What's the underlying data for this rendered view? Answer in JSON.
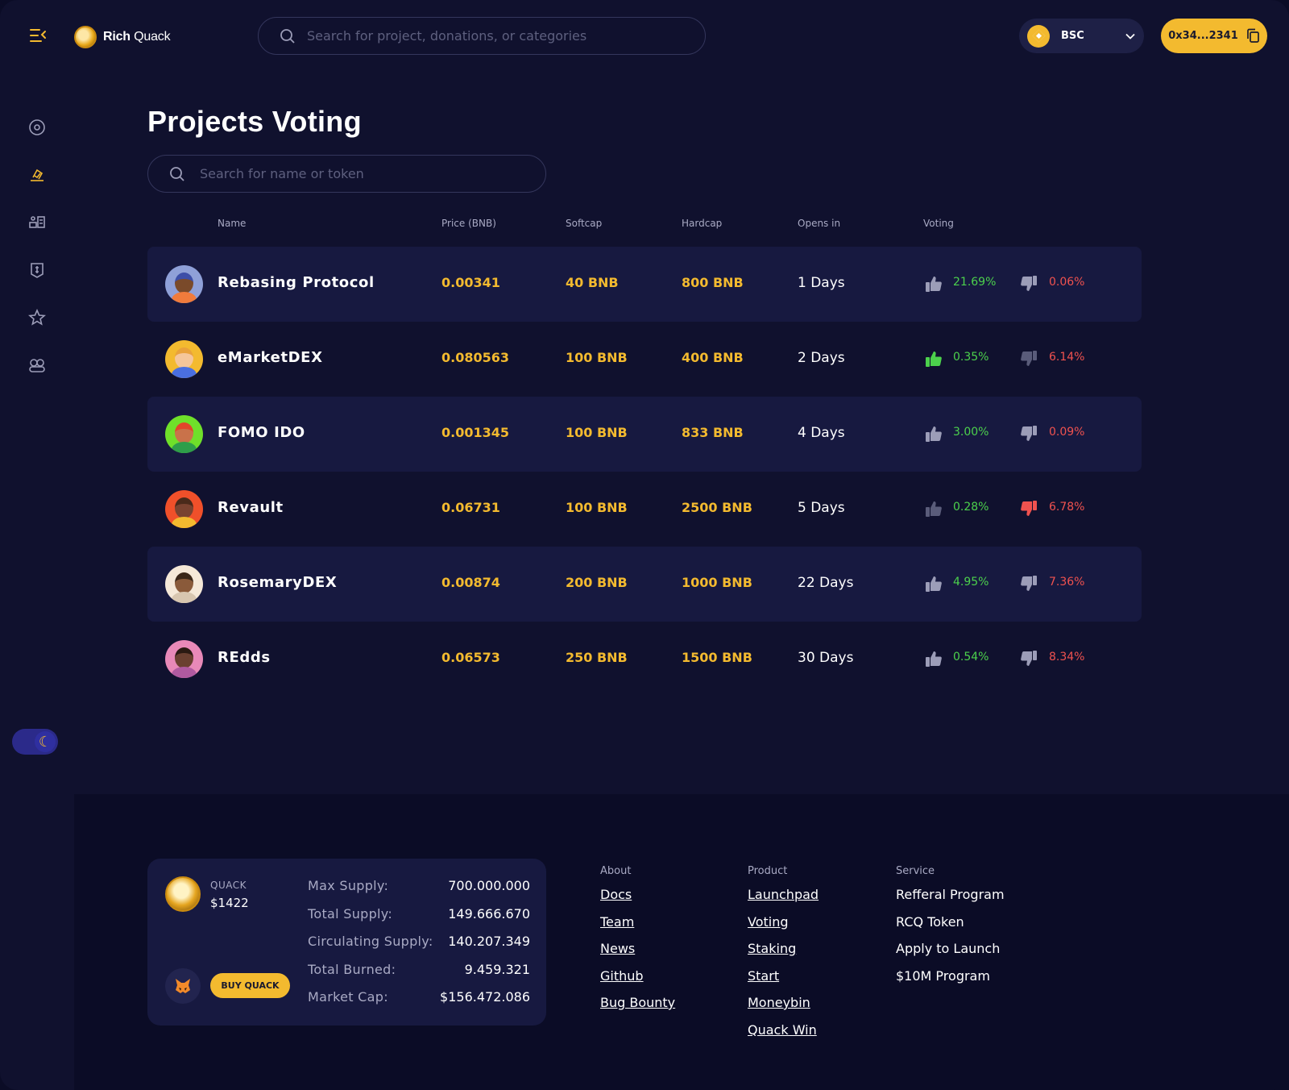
{
  "header": {
    "brand_bold": "Rich",
    "brand_light": " Quack",
    "search_placeholder": "Search for project, donations, or categories",
    "network": "BSC",
    "wallet": "0x34...2341"
  },
  "page": {
    "title": "Projects Voting",
    "search_placeholder": "Search for name or token"
  },
  "table": {
    "columns": [
      "Name",
      "Price (BNB)",
      "Softcap",
      "Hardcap",
      "Opens in",
      "Voting"
    ],
    "rows": [
      {
        "name": "Rebasing Protocol",
        "price": "0.00341",
        "softcap": "40 BNB",
        "hardcap": "800 BNB",
        "opens": "1 Days",
        "up": "21.69%",
        "down": "0.06%",
        "vote": "none"
      },
      {
        "name": "eMarketDEX",
        "price": "0.080563",
        "softcap": "100 BNB",
        "hardcap": "400 BNB",
        "opens": "2 Days",
        "up": "0.35%",
        "down": "6.14%",
        "vote": "up"
      },
      {
        "name": "FOMO IDO",
        "price": "0.001345",
        "softcap": "100 BNB",
        "hardcap": "833 BNB",
        "opens": "4 Days",
        "up": "3.00%",
        "down": "0.09%",
        "vote": "none"
      },
      {
        "name": "Revault",
        "price": "0.06731",
        "softcap": "100 BNB",
        "hardcap": "2500 BNB",
        "opens": "5 Days",
        "up": "0.28%",
        "down": "6.78%",
        "vote": "down"
      },
      {
        "name": "RosemaryDEX",
        "price": "0.00874",
        "softcap": "200 BNB",
        "hardcap": "1000 BNB",
        "opens": "22 Days",
        "up": "4.95%",
        "down": "7.36%",
        "vote": "none"
      },
      {
        "name": "REdds",
        "price": "0.06573",
        "softcap": "250 BNB",
        "hardcap": "1500 BNB",
        "opens": "30 Days",
        "up": "0.54%",
        "down": "8.34%",
        "vote": "none"
      }
    ]
  },
  "footer": {
    "token": {
      "symbol": "QUACK",
      "price": "$1422",
      "buy_label": "BUY QUACK",
      "stats": [
        {
          "label": "Max Supply:",
          "value": "700.000.000"
        },
        {
          "label": "Total Supply:",
          "value": "149.666.670"
        },
        {
          "label": "Circulating Supply:",
          "value": "140.207.349"
        },
        {
          "label": "Total Burned:",
          "value": "9.459.321"
        },
        {
          "label": "Market Cap:",
          "value": "$156.472.086"
        }
      ]
    },
    "about": {
      "title": "About",
      "links": [
        "Docs",
        "Team",
        "News",
        "Github",
        "Bug Bounty"
      ]
    },
    "product": {
      "title": "Product",
      "links": [
        "Launchpad",
        "Voting",
        "Staking",
        "Start",
        "Moneybin",
        "Quack Win"
      ]
    },
    "service": {
      "title": "Service",
      "links": [
        "Refferal Program",
        "RCQ Token",
        "Apply to Launch",
        "$10M Program"
      ]
    }
  },
  "colors": {
    "background": "#10112e",
    "row_alt": "#171940",
    "accent": "#f3ba2f",
    "positive": "#4cd14c",
    "negative": "#f0524f",
    "muted": "#a9aac4"
  },
  "icons": {
    "sidebar": [
      "dashboard-icon",
      "voting-icon",
      "launchpad-icon",
      "staking-icon",
      "favorites-icon",
      "community-icon"
    ]
  }
}
